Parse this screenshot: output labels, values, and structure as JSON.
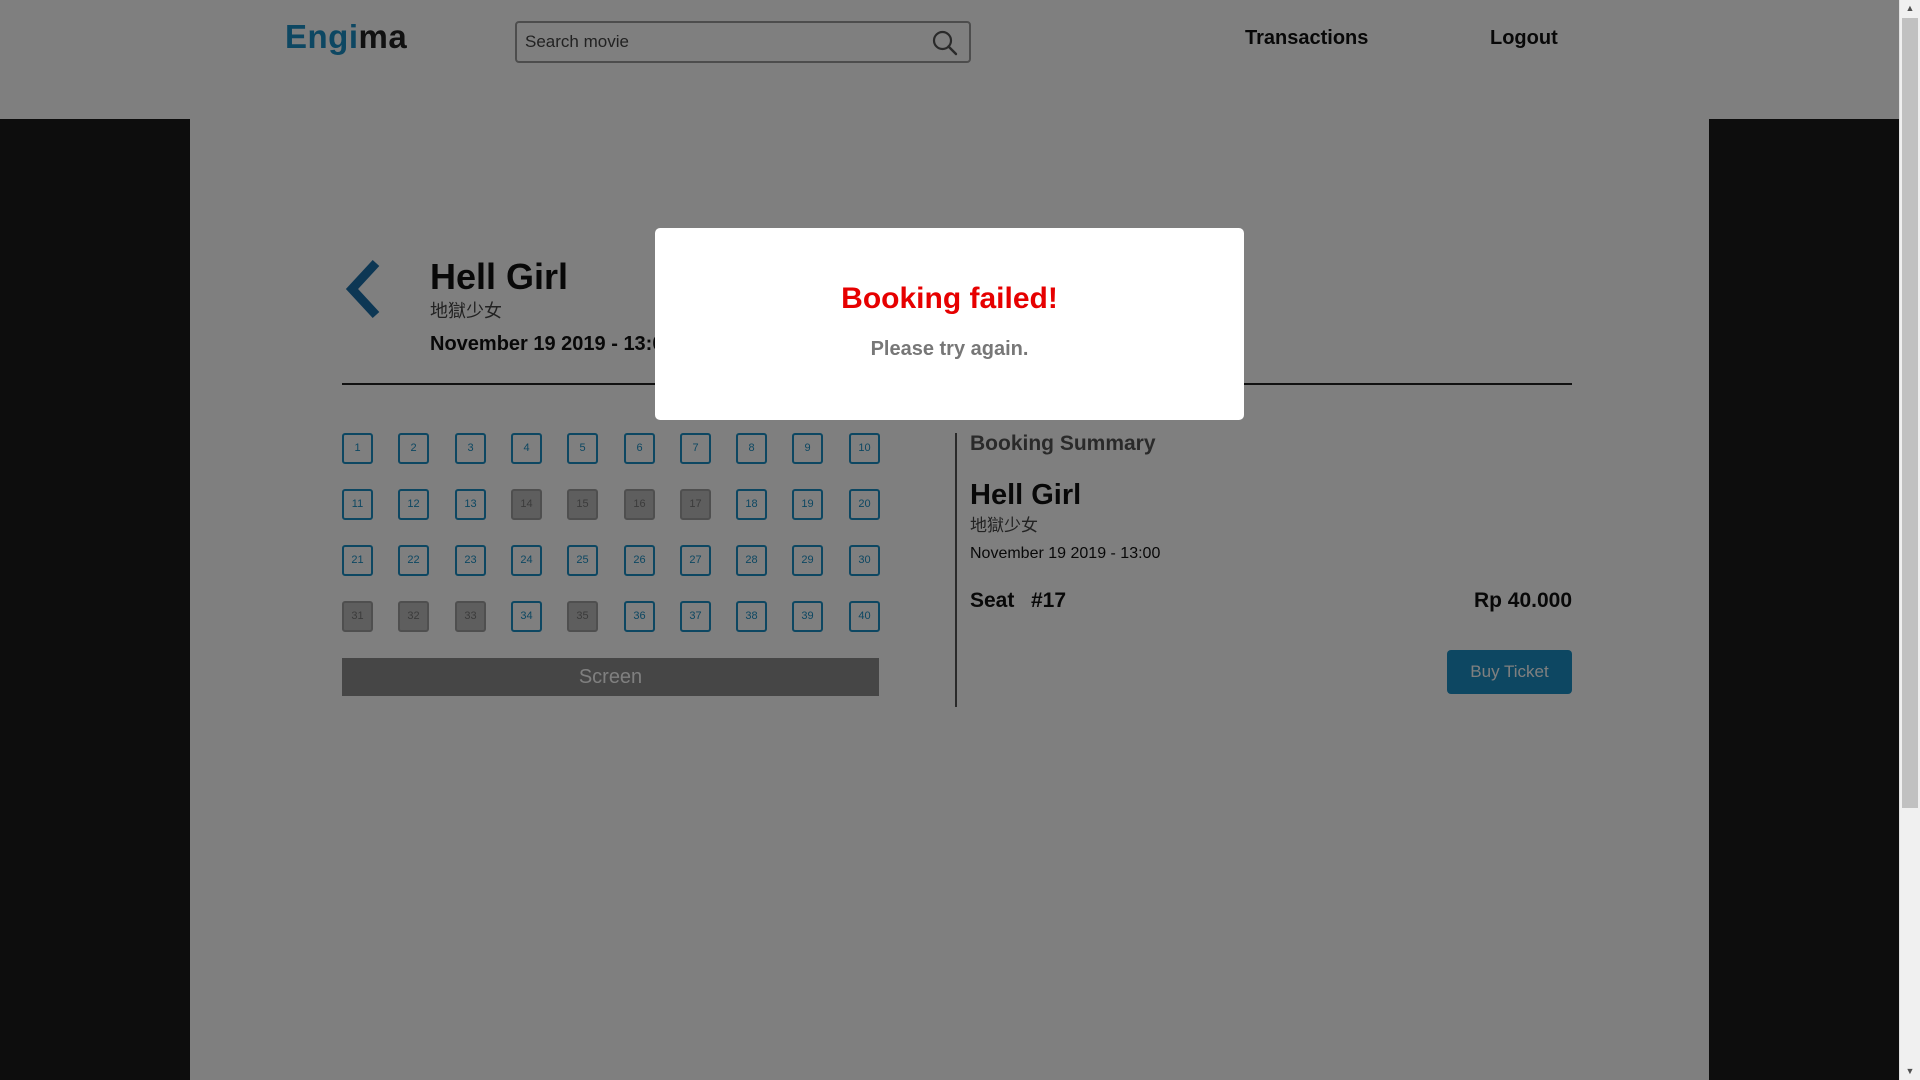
{
  "header": {
    "logo_part1": "Eng",
    "logo_part2": "i",
    "logo_part3": "ma",
    "search_placeholder": "Search movie",
    "nav_transactions": "Transactions",
    "nav_logout": "Logout"
  },
  "movie": {
    "title": "Hell Girl",
    "subtitle": "地獄少女",
    "datetime": "November 19 2019 - 13:00"
  },
  "seats": {
    "numbers": [
      "1",
      "2",
      "3",
      "4",
      "5",
      "6",
      "7",
      "8",
      "9",
      "10",
      "11",
      "12",
      "13",
      "14",
      "15",
      "16",
      "17",
      "18",
      "19",
      "20",
      "21",
      "22",
      "23",
      "24",
      "25",
      "26",
      "27",
      "28",
      "29",
      "30",
      "31",
      "32",
      "33",
      "34",
      "35",
      "36",
      "37",
      "38",
      "39",
      "40"
    ],
    "taken": [
      "14",
      "15",
      "16",
      "17",
      "31",
      "32",
      "33",
      "35"
    ],
    "screen_label": "Screen"
  },
  "summary": {
    "heading": "Booking Summary",
    "title": "Hell Girl",
    "subtitle": "地獄少女",
    "datetime": "November 19 2019 - 13:00",
    "seat_label": "Seat",
    "seat_number": "#17",
    "price": "Rp 40.000",
    "buy_label": "Buy Ticket"
  },
  "modal": {
    "title": "Booking failed!",
    "message": "Please try again."
  },
  "colors": {
    "accent": "#1a8fc4",
    "error": "#e60000"
  }
}
